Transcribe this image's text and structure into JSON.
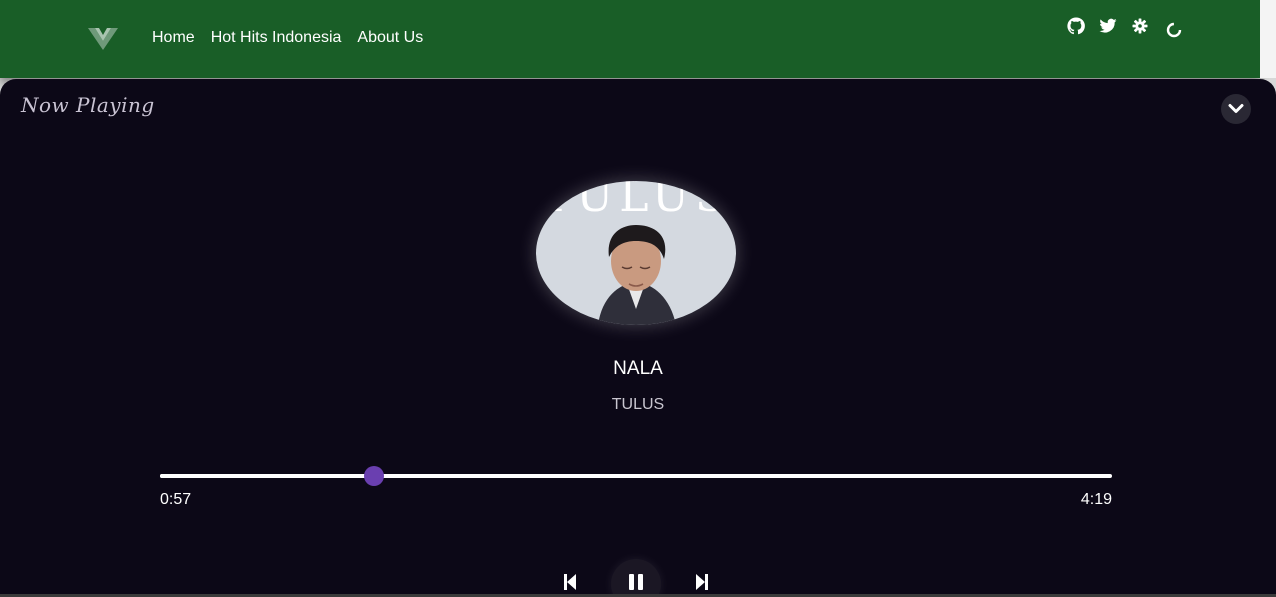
{
  "nav": {
    "links": [
      "Home",
      "Hot Hits Indonesia",
      "About Us"
    ]
  },
  "icons": {
    "logo": "v-logo-icon",
    "github": "github-icon",
    "twitter": "twitter-icon",
    "settings": "gear-icon",
    "loading": "loading-spinner-icon",
    "collapse": "chevron-down-icon",
    "previous": "skip-previous-icon",
    "pause": "pause-icon",
    "next": "skip-next-icon"
  },
  "player": {
    "heading": "Now Playing",
    "song_title": "NALA",
    "artist": "TULUS",
    "cover_text": "TULUS",
    "elapsed": "0:57",
    "duration": "4:19",
    "progress_fraction": 0.225
  },
  "colors": {
    "header_bg": "#195e27",
    "panel_bg": "#0c0817",
    "accent": "#6a3fb0"
  }
}
